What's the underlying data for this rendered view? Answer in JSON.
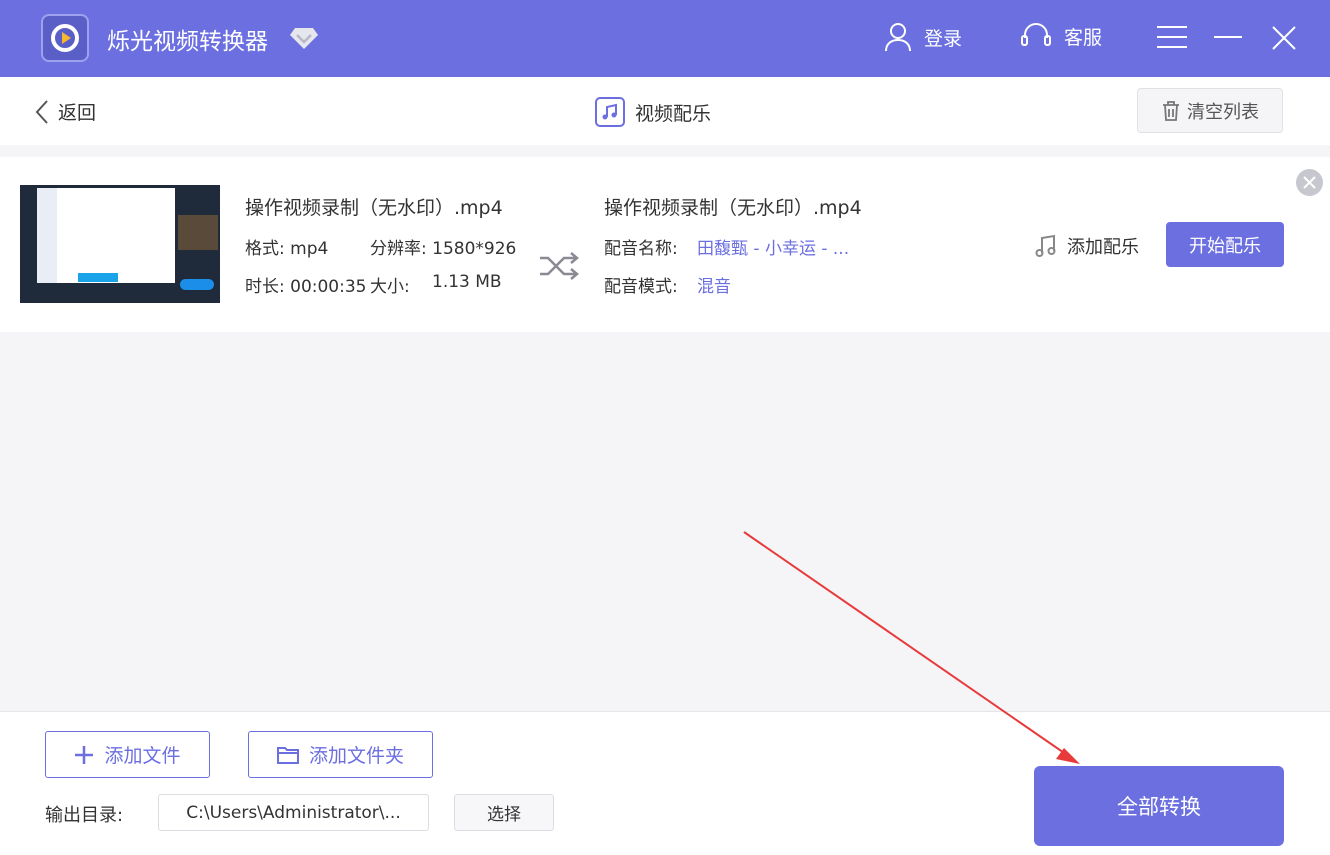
{
  "app": {
    "title": "烁光视频转换器",
    "login": "登录",
    "service": "客服"
  },
  "subbar": {
    "back": "返回",
    "page_title": "视频配乐",
    "clear": "清空列表"
  },
  "file": {
    "source_name": "操作视频录制（无水印）.mp4",
    "format": "格式: mp4",
    "resolution": "分辨率: 1580*926",
    "duration": "时长: 00:00:35",
    "size_label": "大小:",
    "size": "1.13 MB",
    "target_name": "操作视频录制（无水印）.mp4",
    "music_name_label": "配音名称:",
    "music_name": "田馥甄 - 小幸运 - ...",
    "music_mode_label": "配音模式:",
    "music_mode": "混音",
    "add_music": "添加配乐",
    "start": "开始配乐"
  },
  "bottom": {
    "add_file": "添加文件",
    "add_folder": "添加文件夹",
    "output_label": "输出目录:",
    "output_path": "C:\\Users\\Administrator\\...",
    "choose": "选择",
    "convert_all": "全部转换"
  },
  "colors": {
    "accent": "#6b6fe0",
    "arrow": "#e83a3a"
  }
}
